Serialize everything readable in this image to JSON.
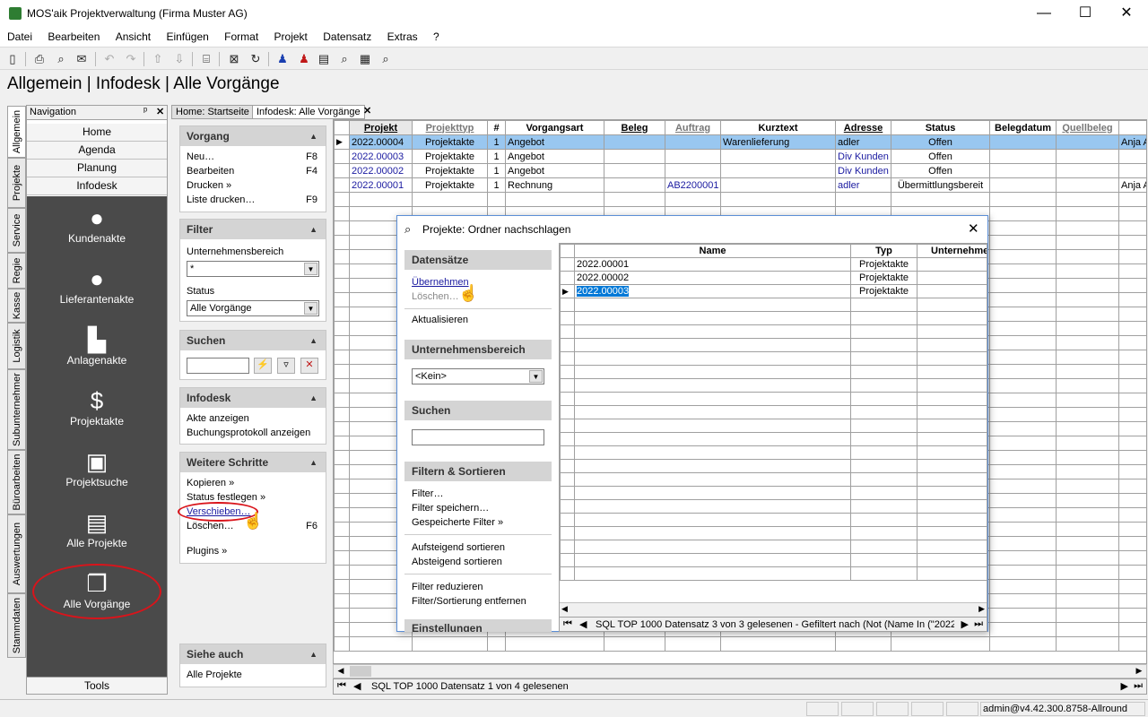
{
  "window": {
    "title": "MOS'aik Projektverwaltung (Firma Muster AG)",
    "minimize": "—",
    "maximize": "☐",
    "close": "✕"
  },
  "menu": [
    "Datei",
    "Bearbeiten",
    "Ansicht",
    "Einfügen",
    "Format",
    "Projekt",
    "Datensatz",
    "Extras",
    "?"
  ],
  "page_title": "Allgemein | Infodesk | Alle Vorgänge",
  "left_tabs": [
    "Allgemein",
    "Projekte",
    "Service",
    "Regie",
    "Kasse",
    "Logistik",
    "Subunternehmer",
    "Büroarbeiten",
    "Auswertungen",
    "Stammdaten"
  ],
  "navigation": {
    "title": "Navigation",
    "pin": "ᵖ",
    "close": "✕",
    "buttons": [
      "Home",
      "Agenda",
      "Planung",
      "Infodesk"
    ],
    "items": [
      {
        "label": "Kundenakte",
        "icon": "person-icon"
      },
      {
        "label": "Lieferantenakte",
        "icon": "supplier-icon"
      },
      {
        "label": "Anlagenakte",
        "icon": "factory-icon"
      },
      {
        "label": "Projektakte",
        "icon": "money-icon"
      },
      {
        "label": "Projektsuche",
        "icon": "folder-search-icon"
      },
      {
        "label": "Alle Projekte",
        "icon": "folders-icon"
      },
      {
        "label": "Alle Vorgänge",
        "icon": "documents-icon"
      }
    ],
    "tools": "Tools"
  },
  "tasks": {
    "vorgang": {
      "title": "Vorgang",
      "items": [
        {
          "label": "Neu…",
          "key": "F8"
        },
        {
          "label": "Bearbeiten",
          "key": "F4"
        },
        {
          "label": "Drucken »",
          "key": ""
        },
        {
          "label": "Liste drucken…",
          "key": "F9"
        }
      ]
    },
    "filter": {
      "title": "Filter",
      "bereich_label": "Unternehmensbereich",
      "bereich_value": "*",
      "status_label": "Status",
      "status_value": "Alle Vorgänge"
    },
    "suchen": {
      "title": "Suchen",
      "value": ""
    },
    "infodesk": {
      "title": "Infodesk",
      "items": [
        "Akte anzeigen",
        "Buchungsprotokoll anzeigen"
      ]
    },
    "weitere": {
      "title": "Weitere Schritte",
      "items": [
        {
          "label": "Kopieren »",
          "key": ""
        },
        {
          "label": "Status festlegen »",
          "key": ""
        },
        {
          "label": "Verschieben…",
          "key": ""
        },
        {
          "label": "Löschen…",
          "key": "F6"
        },
        {
          "label": "Plugins »",
          "key": ""
        }
      ]
    },
    "siehe": {
      "title": "Siehe auch",
      "items": [
        "Alle Projekte"
      ]
    }
  },
  "doc_tabs": [
    "Home: Startseite",
    "Infodesk: Alle Vorgänge"
  ],
  "grid": {
    "columns": [
      "Projekt",
      "Projekttyp",
      "#",
      "Vorgangsart",
      "Beleg",
      "Auftrag",
      "Kurztext",
      "Adresse",
      "Status",
      "Belegdatum",
      "Quellbeleg",
      ""
    ],
    "rows": [
      [
        "2022.00004",
        "Projektakte",
        "1",
        "Angebot",
        "",
        "",
        "Warenlieferung",
        "adler",
        "Offen",
        "",
        "",
        "Anja A"
      ],
      [
        "2022.00003",
        "Projektakte",
        "1",
        "Angebot",
        "",
        "",
        "",
        "Div Kunden",
        "Offen",
        "",
        "",
        ""
      ],
      [
        "2022.00002",
        "Projektakte",
        "1",
        "Angebot",
        "",
        "",
        "",
        "Div Kunden",
        "Offen",
        "",
        "",
        ""
      ],
      [
        "2022.00001",
        "Projektakte",
        "1",
        "Rechnung",
        "",
        "AB2200001",
        "",
        "adler",
        "Übermittlungsbereit",
        "",
        "",
        "Anja A"
      ]
    ],
    "status": "SQL TOP 1000 Datensatz 1 von 4 gelesenen"
  },
  "dialog": {
    "title": "Projekte: Ordner nachschlagen",
    "datensaetze": {
      "title": "Datensätze",
      "items": [
        "Übernehmen",
        "Löschen…",
        "Aktualisieren"
      ]
    },
    "bereich": {
      "title": "Unternehmensbereich",
      "value": "<Kein>"
    },
    "suchen": {
      "title": "Suchen",
      "value": ""
    },
    "filtern": {
      "title": "Filtern & Sortieren",
      "items": [
        "Filter…",
        "Filter speichern…",
        "Gespeicherte Filter »",
        "Aufsteigend sortieren",
        "Absteigend sortieren",
        "Filter reduzieren",
        "Filter/Sortierung entfernen"
      ]
    },
    "einstellungen": {
      "title": "Einstellungen"
    },
    "columns": [
      "Name",
      "Typ",
      "Unternehmen"
    ],
    "rows": [
      [
        "2022.00001",
        "Projektakte"
      ],
      [
        "2022.00002",
        "Projektakte"
      ],
      [
        "2022.00003",
        "Projektakte"
      ]
    ],
    "status": "SQL TOP 1000 Datensatz 3 von 3 gelesenen - Gefiltert nach (Not (Name In (\"2022."
  },
  "statusbar": {
    "user": "admin@v4.42.300.8758-Allround"
  },
  "colors": {
    "highlight": "#99c7f0",
    "link": "#1a1aa0",
    "annotation": "#d9141b",
    "nav_dark": "#4a4a4a"
  }
}
